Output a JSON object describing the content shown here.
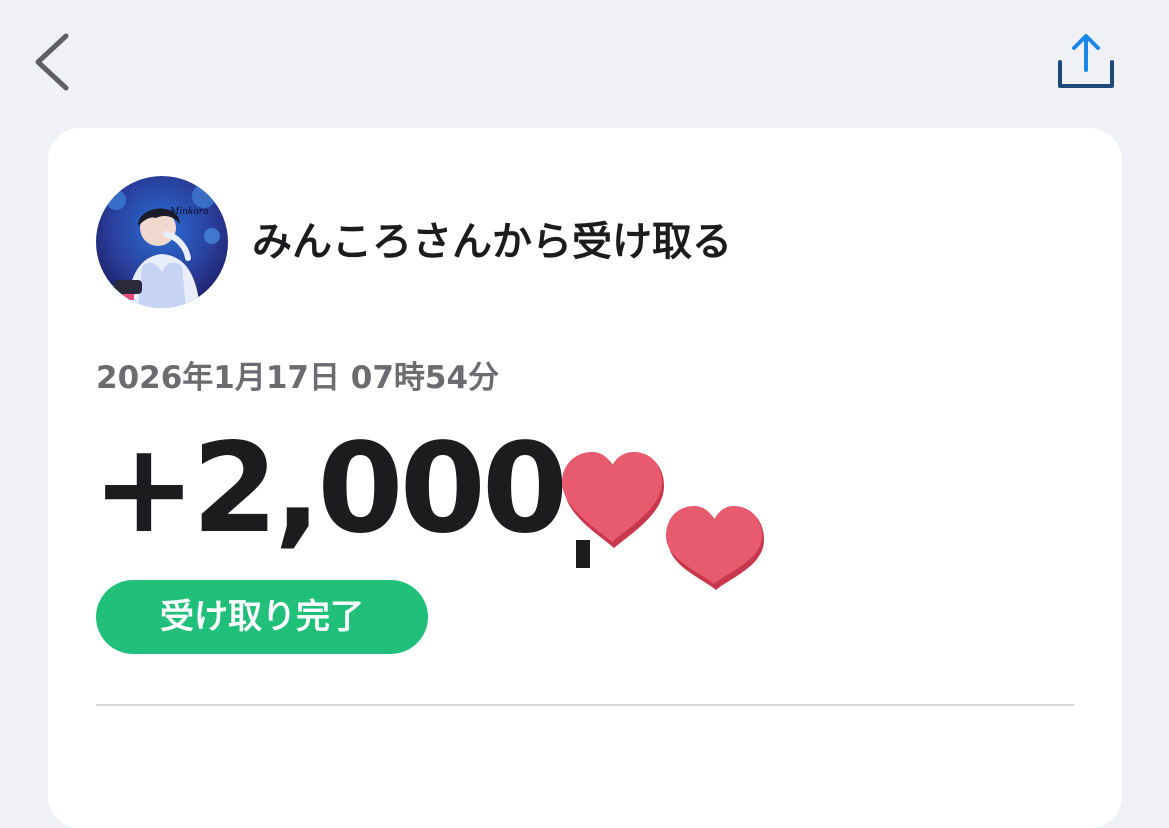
{
  "nav": {
    "back_icon": "chevron-left-icon",
    "share_icon": "share-icon"
  },
  "card": {
    "sender_title": "みんころさんから受け取る",
    "avatar_text": "Minkoro",
    "timestamp": "2026年1月17日 07時54分",
    "amount": "+2,000",
    "status": "受け取り完了"
  },
  "colors": {
    "background": "#eff1f6",
    "card": "#ffffff",
    "status_green": "#21c07a",
    "share_blue": "#1a86e8",
    "heart_pink": "#e85a6e"
  }
}
